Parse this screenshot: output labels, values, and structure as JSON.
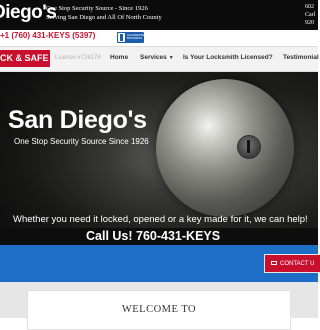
{
  "header": {
    "logo": "Diego's",
    "tagline1": "One Stop Security Source - Since 1926",
    "tagline2": "Serving San Diego and All Of North County",
    "address": [
      "602",
      "Carl",
      "920"
    ]
  },
  "phonebar": {
    "phone": "+1 (760) 431-KEYS (5397)",
    "bbb_label": "ACCREDITED BUSINESS"
  },
  "nav": {
    "brand": "CK & SAFE",
    "license": "License #726174",
    "items": [
      {
        "label": "Home"
      },
      {
        "label": "Services",
        "has_dropdown": true
      },
      {
        "label": "Is Your Locksmith Licensed?"
      },
      {
        "label": "Testimonial"
      }
    ]
  },
  "hero": {
    "title": "San Diego's",
    "subtitle": "One Stop Security Source Since 1926",
    "message": "Whether you need it locked, opened or a key made for it, we can help!",
    "call_text": "Call Us! 760-431-KEYS"
  },
  "contact": {
    "button_label": "CONTACT U"
  },
  "welcome": {
    "title": "WELCOME TO"
  },
  "colors": {
    "brand_red": "#c8102e",
    "blue_bar": "#1e6ec8",
    "top_bar": "#0b0b0b"
  }
}
